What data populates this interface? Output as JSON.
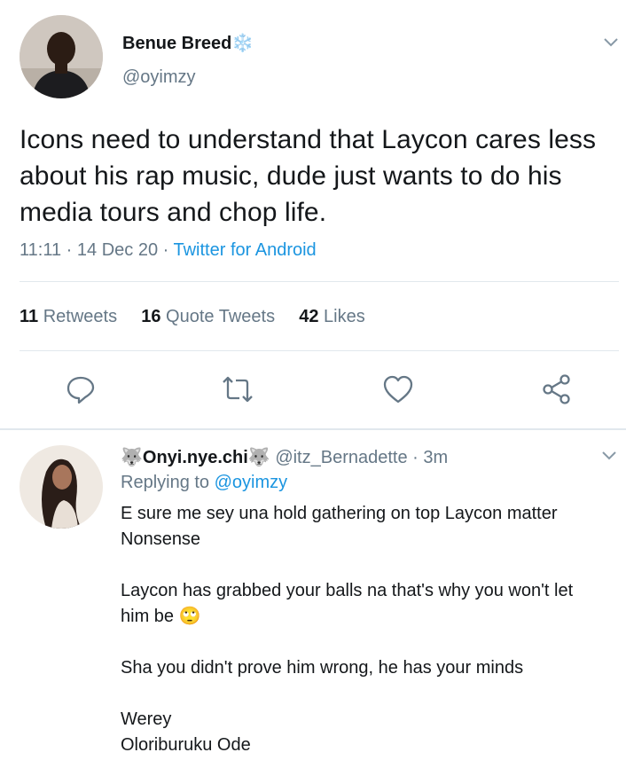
{
  "tweet": {
    "author_name": "Benue Breed",
    "author_emoji": "❄️",
    "author_handle": "@oyimzy",
    "text": "Icons need to understand that Laycon cares less about his rap music, dude just wants to do his media tours and chop life.",
    "time": "11:11",
    "date": "14 Dec 20",
    "source": "Twitter for Android",
    "sep": "·",
    "stats": {
      "retweets_count": "11",
      "retweets_label": "Retweets",
      "quotes_count": "16",
      "quotes_label": "Quote Tweets",
      "likes_count": "42",
      "likes_label": "Likes"
    },
    "actions": [
      "reply-icon",
      "retweet-icon",
      "like-icon",
      "share-icon"
    ]
  },
  "reply": {
    "author_name": "Onyi.nye.chi",
    "author_emoji": "🐺",
    "author_handle": "@itz_Bernadette",
    "time_ago": "3m",
    "replying_label": "Replying to",
    "replying_to": "@oyimzy",
    "lines": {
      "l1": "E sure me sey una hold gathering on top Laycon matter",
      "l2": "Nonsense",
      "l3": "Laycon has grabbed your balls na that's why you won't let",
      "l4": "him be",
      "l4_emoji": "🙄",
      "l5": "Sha you didn't prove him wrong, he has your minds",
      "l6": "Werey",
      "l7": "Oloriburuku Ode"
    }
  },
  "colors": {
    "text": "#14171a",
    "secondary": "#657786",
    "link": "#1b95e0",
    "divider": "#e1e8ed"
  }
}
